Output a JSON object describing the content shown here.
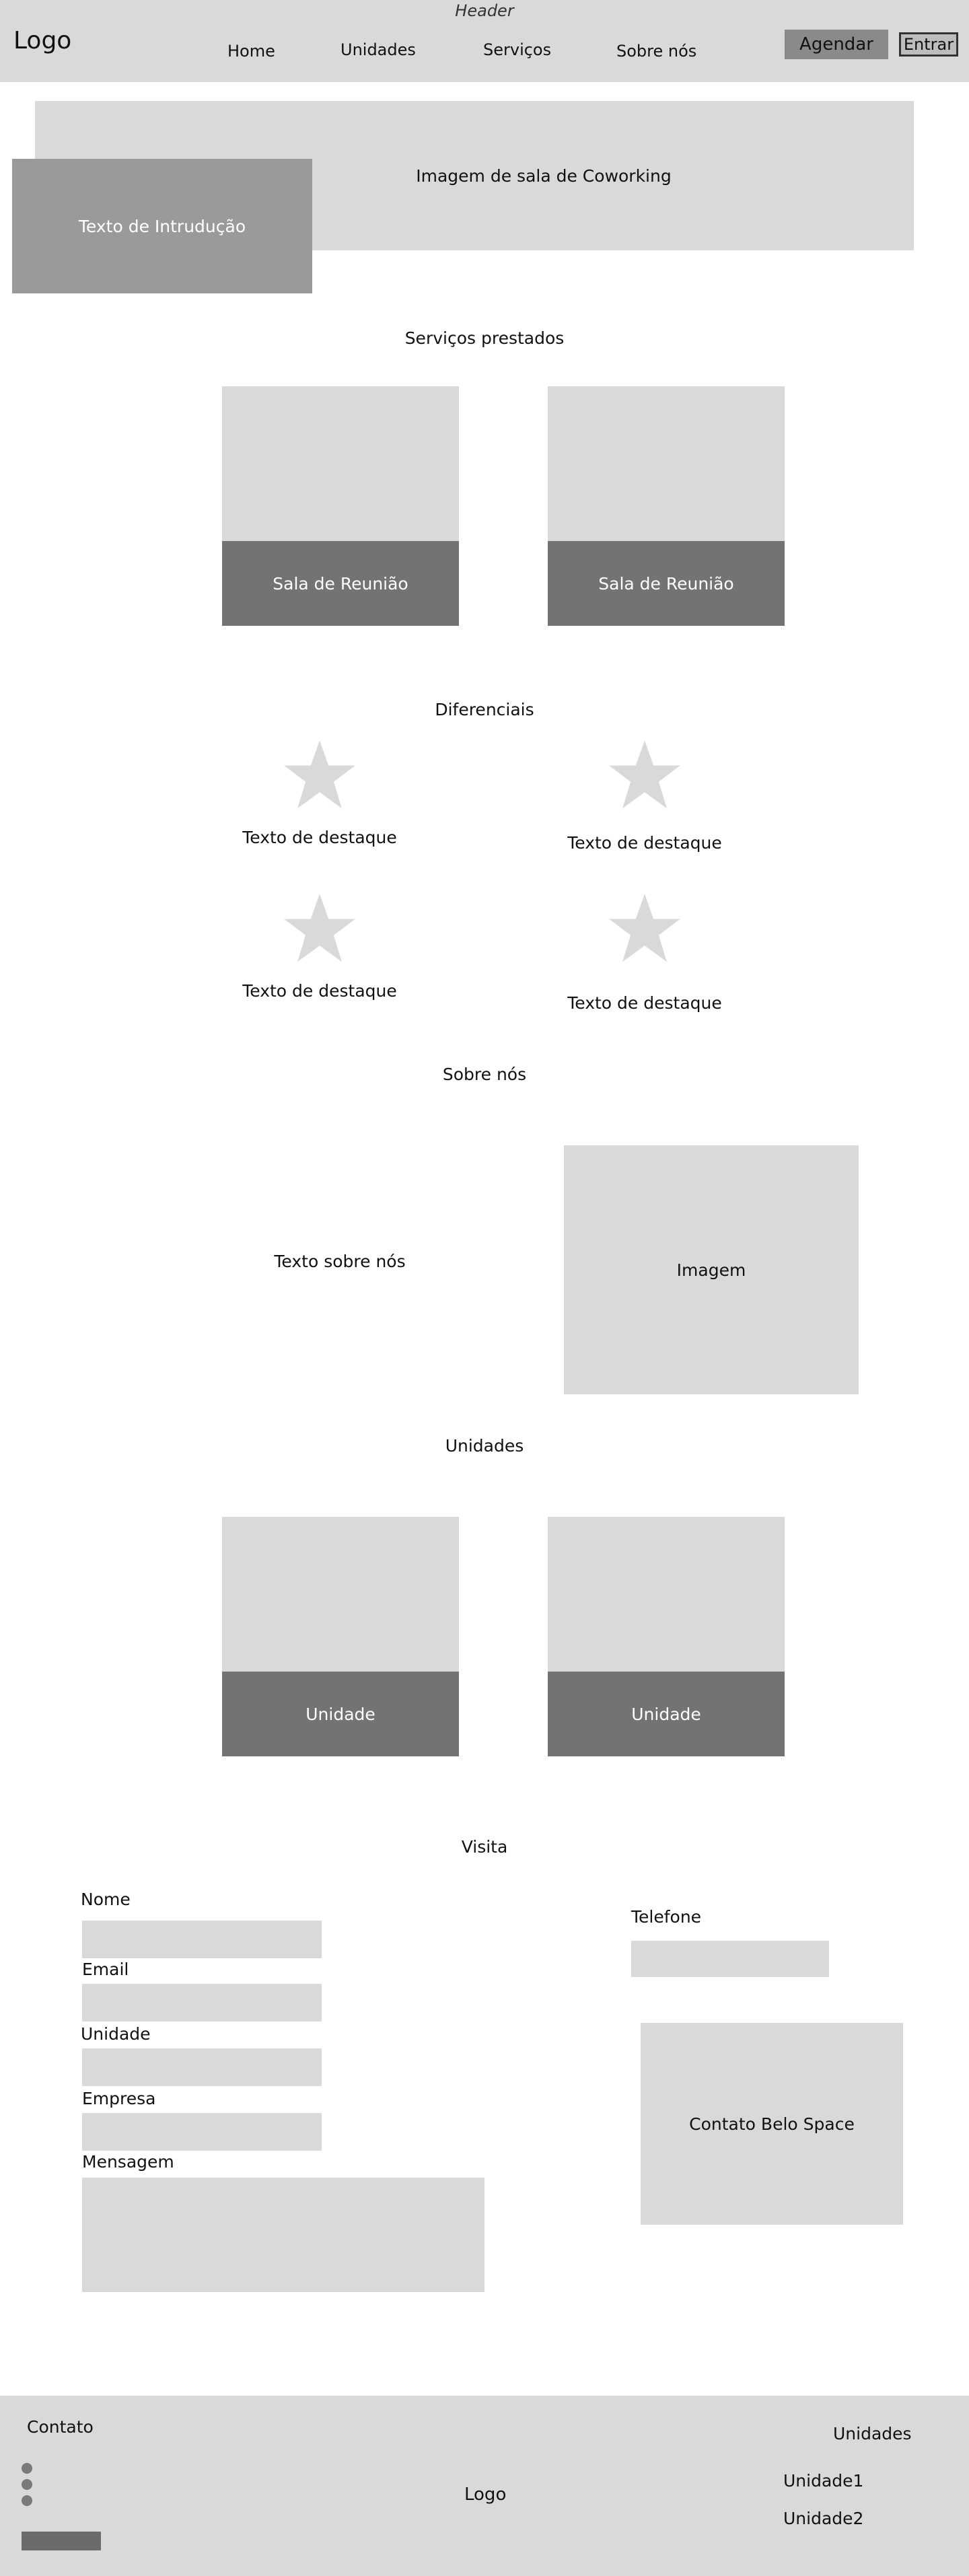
{
  "header": {
    "label": "Header",
    "logo": "Logo",
    "nav": [
      {
        "label": "Home"
      },
      {
        "label": "Unidades"
      },
      {
        "label": "Serviços"
      },
      {
        "label": "Sobre nós"
      }
    ],
    "agendar_label": "Agendar",
    "entrar_label": "Entrar"
  },
  "hero": {
    "image_label": "Imagem de sala de Coworking",
    "intro_label": "Texto de Intrudução"
  },
  "services": {
    "title": "Serviços prestados",
    "cards": [
      {
        "label": "Sala de Reunião"
      },
      {
        "label": "Sala de Reunião"
      }
    ]
  },
  "differentials": {
    "title": "Diferenciais",
    "items": [
      {
        "icon": "star-icon",
        "label": "Texto de destaque"
      },
      {
        "icon": "star-icon",
        "label": "Texto de destaque"
      },
      {
        "icon": "star-icon",
        "label": "Texto de destaque"
      },
      {
        "icon": "star-icon",
        "label": "Texto de destaque"
      }
    ]
  },
  "about": {
    "title": "Sobre nós",
    "text": "Texto sobre nós",
    "image_label": "Imagem"
  },
  "units": {
    "title": "Unidades",
    "cards": [
      {
        "label": "Unidade"
      },
      {
        "label": "Unidade"
      }
    ]
  },
  "visit": {
    "title": "Visita",
    "fields": {
      "name": "Nome",
      "email": "Email",
      "unit": "Unidade",
      "company": "Empresa",
      "message": "Mensagem",
      "phone": "Telefone"
    },
    "contact_box": "Contato Belo Space"
  },
  "footer": {
    "contact_title": "Contato",
    "logo": "Logo",
    "units_title": "Unidades",
    "units": [
      "Unidade1",
      "Unidade2"
    ]
  },
  "colors": {
    "background": "#ffffff",
    "light_gray": "#d9d9d9",
    "mid_gray": "#9a9a9a",
    "dark_gray": "#737373",
    "button_gray": "#8a8a8a"
  }
}
